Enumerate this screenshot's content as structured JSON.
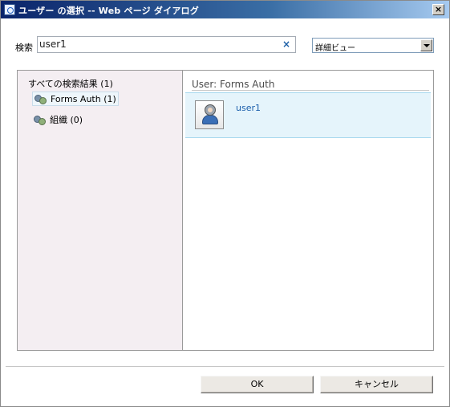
{
  "window": {
    "title": "ユーザー の選択 -- Web ページ ダイアログ",
    "close_glyph": "×"
  },
  "search": {
    "label": "検索",
    "value": "user1",
    "clear_glyph": "×"
  },
  "view_selector": {
    "selected": "詳細ビュー"
  },
  "left_panel": {
    "all_results": "すべての検索結果 (1)",
    "items": [
      {
        "label": "Forms Auth (1)",
        "icon": "group-icon",
        "selected": true
      },
      {
        "label": "組織 (0)",
        "icon": "group-icon",
        "selected": false
      }
    ]
  },
  "right_panel": {
    "section_header": "User: Forms Auth",
    "results": [
      {
        "name": "user1",
        "icon": "user-avatar-icon"
      }
    ]
  },
  "footer": {
    "ok_label": "OK",
    "cancel_label": "キャンセル"
  },
  "colors": {
    "titlebar": "#0a246a",
    "left_panel_bg": "#f4eef2",
    "selected_row_bg": "#e5f4fb",
    "link": "#1b5eab"
  }
}
